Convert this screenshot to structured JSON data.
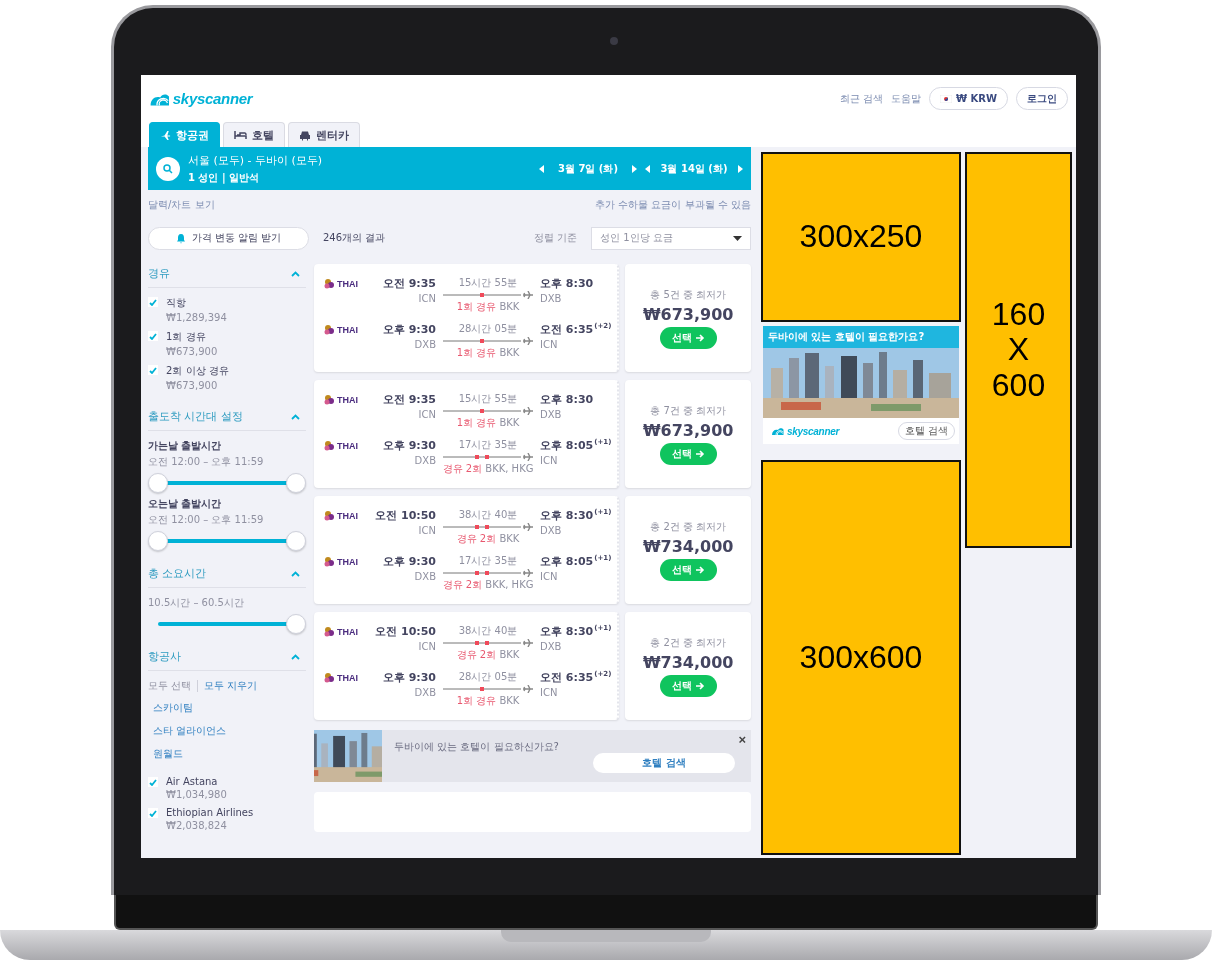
{
  "header": {
    "logo": "skyscanner",
    "links": [
      "최근 검색",
      "도움말"
    ],
    "currency": "₩ KRW",
    "login": "로그인"
  },
  "tabs": [
    {
      "label": "항공권",
      "kind": "flight",
      "selected": true
    },
    {
      "label": "호텔",
      "kind": "hotel",
      "selected": false
    },
    {
      "label": "렌터카",
      "kind": "car",
      "selected": false
    }
  ],
  "search": {
    "route": "서울 (모두) - 두바이 (모두)",
    "details": "1 성인 | 일반석",
    "dates": [
      "3월 7일 (화)",
      "3월 14일 (화)"
    ]
  },
  "calendar_link": "달력/차트 보기",
  "baggage_note": "추가 수하물 요금이 부과될 수 있음",
  "price_alert_button": "가격 변동 알림 받기",
  "result_count": "246개의 결과",
  "sort": {
    "label": "정렬 기준",
    "value": "성인 1인당 요금"
  },
  "filters": [
    {
      "title": "경유",
      "kind": "checklist",
      "expanded": true,
      "items": [
        {
          "label": "직항",
          "price": "₩1,289,394",
          "checked": true
        },
        {
          "label": "1회 경유",
          "price": "₩673,900",
          "checked": true
        },
        {
          "label": "2회 이상 경유",
          "price": "₩673,900",
          "checked": true
        }
      ]
    },
    {
      "title": "출도착 시간대 설정",
      "kind": "sliders",
      "expanded": true,
      "sliders": [
        {
          "label": "가는날 출발시간",
          "range": "오전 12:00 – 오후 11:59",
          "kind": "range",
          "level": 1
        },
        {
          "label": "오는날 출발시간",
          "range": "오전 12:00 – 오후 11:59",
          "kind": "range",
          "level": 1
        }
      ]
    },
    {
      "title": "총 소요시간",
      "kind": "sliders",
      "expanded": true,
      "sliders": [
        {
          "range": "10.5시간 – 60.5시간",
          "kind": "single",
          "level": 1
        }
      ]
    },
    {
      "title": "항공사",
      "kind": "airlines",
      "expanded": true,
      "actions": [
        "모두 선택",
        "모두 지우기"
      ],
      "alliances": [
        "스카이팀",
        "스타 얼라이언스",
        "원월드"
      ],
      "items": [
        {
          "label": "Air Astana",
          "price": "₩1,034,980",
          "checked": true
        },
        {
          "label": "Ethiopian Airlines",
          "price": "₩2,038,824",
          "checked": true
        }
      ]
    }
  ],
  "results": [
    {
      "legs": [
        {
          "airline": "THAI",
          "depart_time": "오전 9:35",
          "depart_code": "ICN",
          "duration": "15시간 55분",
          "kind": "one_stop",
          "stop_label": "1회 경유",
          "stop_airports": "BKK",
          "arrive_time": "오후 8:30",
          "arrive_code": "DXB"
        },
        {
          "airline": "THAI",
          "depart_time": "오후 9:30",
          "depart_code": "DXB",
          "duration": "28시간 05분",
          "kind": "one_stop",
          "stop_label": "1회 경유",
          "stop_airports": "BKK",
          "arrive_time": "오전 6:35",
          "day_offset": "(+2)",
          "arrive_code": "ICN"
        }
      ],
      "deals": "총 5건 중 최저가",
      "price": "₩673,900",
      "button": "선택"
    },
    {
      "legs": [
        {
          "airline": "THAI",
          "depart_time": "오전 9:35",
          "depart_code": "ICN",
          "duration": "15시간 55분",
          "kind": "one_stop",
          "stop_label": "1회 경유",
          "stop_airports": "BKK",
          "arrive_time": "오후 8:30",
          "arrive_code": "DXB"
        },
        {
          "airline": "THAI",
          "depart_time": "오후 9:30",
          "depart_code": "DXB",
          "duration": "17시간 35분",
          "kind": "two_stop",
          "stop_label": "경유 2회",
          "stop_airports": "BKK, HKG",
          "arrive_time": "오후 8:05",
          "day_offset": "(+1)",
          "arrive_code": "ICN"
        }
      ],
      "deals": "총 7건 중 최저가",
      "price": "₩673,900",
      "button": "선택"
    },
    {
      "legs": [
        {
          "airline": "THAI",
          "depart_time": "오전 10:50",
          "depart_code": "ICN",
          "duration": "38시간 40분",
          "kind": "two_stop",
          "stop_label": "경유 2회",
          "stop_airports": "BKK",
          "arrive_time": "오후 8:30",
          "day_offset": "(+1)",
          "arrive_code": "DXB"
        },
        {
          "airline": "THAI",
          "depart_time": "오후 9:30",
          "depart_code": "DXB",
          "duration": "17시간 35분",
          "kind": "two_stop",
          "stop_label": "경유 2회",
          "stop_airports": "BKK, HKG",
          "arrive_time": "오후 8:05",
          "day_offset": "(+1)",
          "arrive_code": "ICN"
        }
      ],
      "deals": "총 2건 중 최저가",
      "price": "₩734,000",
      "button": "선택"
    },
    {
      "legs": [
        {
          "airline": "THAI",
          "depart_time": "오전 10:50",
          "depart_code": "ICN",
          "duration": "38시간 40분",
          "kind": "two_stop",
          "stop_label": "경유 2회",
          "stop_airports": "BKK",
          "arrive_time": "오후 8:30",
          "day_offset": "(+1)",
          "arrive_code": "DXB"
        },
        {
          "airline": "THAI",
          "depart_time": "오후 9:30",
          "depart_code": "DXB",
          "duration": "28시간 05분",
          "kind": "one_stop",
          "stop_label": "1회 경유",
          "stop_airports": "BKK",
          "arrive_time": "오전 6:35",
          "day_offset": "(+2)",
          "arrive_code": "ICN"
        }
      ],
      "deals": "총 2건 중 최저가",
      "price": "₩734,000",
      "button": "선택"
    }
  ],
  "hotel_banner": {
    "text": "두바이에 있는 호텔이 필요하신가요?",
    "button": "호텔 검색",
    "close": "×"
  },
  "ads": {
    "medium": "300x250",
    "hotel": {
      "title": "두바이에 있는 호텔이 필요한가요?",
      "logo": "skyscanner",
      "button": "호텔 검색"
    },
    "large": "300x600",
    "skyscraper": [
      "160",
      "X",
      "600"
    ]
  }
}
